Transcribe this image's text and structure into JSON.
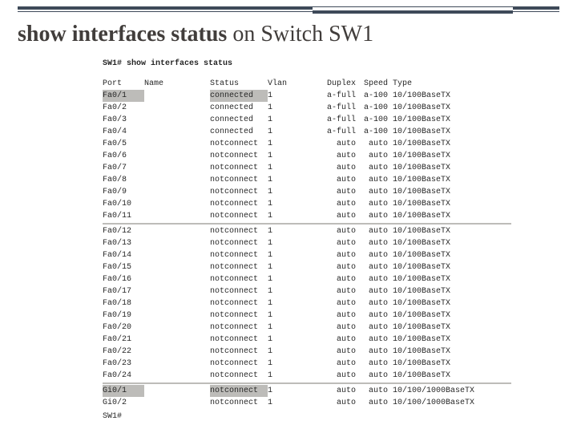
{
  "title_bold": "show interfaces status",
  "title_rest": " on Switch SW1",
  "cmd": "SW1# show interfaces status",
  "headers": {
    "port": "Port",
    "name": "Name",
    "status": "Status",
    "vlan": "Vlan",
    "duplex": "Duplex",
    "speed": "Speed",
    "type": "Type"
  },
  "rows1": [
    {
      "port": "Fa0/1",
      "status": "connected",
      "vlan": "1",
      "duplex": "a-full",
      "speed": "a-100",
      "type": "10/100BaseTX",
      "hl": true
    },
    {
      "port": "Fa0/2",
      "status": "connected",
      "vlan": "1",
      "duplex": "a-full",
      "speed": "a-100",
      "type": "10/100BaseTX",
      "hl": false
    },
    {
      "port": "Fa0/3",
      "status": "connected",
      "vlan": "1",
      "duplex": "a-full",
      "speed": "a-100",
      "type": "10/100BaseTX",
      "hl": false
    },
    {
      "port": "Fa0/4",
      "status": "connected",
      "vlan": "1",
      "duplex": "a-full",
      "speed": "a-100",
      "type": "10/100BaseTX",
      "hl": false
    },
    {
      "port": "Fa0/5",
      "status": "notconnect",
      "vlan": "1",
      "duplex": "auto",
      "speed": "auto",
      "type": "10/100BaseTX",
      "hl": false
    },
    {
      "port": "Fa0/6",
      "status": "notconnect",
      "vlan": "1",
      "duplex": "auto",
      "speed": "auto",
      "type": "10/100BaseTX",
      "hl": false
    },
    {
      "port": "Fa0/7",
      "status": "notconnect",
      "vlan": "1",
      "duplex": "auto",
      "speed": "auto",
      "type": "10/100BaseTX",
      "hl": false
    },
    {
      "port": "Fa0/8",
      "status": "notconnect",
      "vlan": "1",
      "duplex": "auto",
      "speed": "auto",
      "type": "10/100BaseTX",
      "hl": false
    },
    {
      "port": "Fa0/9",
      "status": "notconnect",
      "vlan": "1",
      "duplex": "auto",
      "speed": "auto",
      "type": "10/100BaseTX",
      "hl": false
    },
    {
      "port": "Fa0/10",
      "status": "notconnect",
      "vlan": "1",
      "duplex": "auto",
      "speed": "auto",
      "type": "10/100BaseTX",
      "hl": false
    },
    {
      "port": "Fa0/11",
      "status": "notconnect",
      "vlan": "1",
      "duplex": "auto",
      "speed": "auto",
      "type": "10/100BaseTX",
      "hl": false
    }
  ],
  "rows2": [
    {
      "port": "Fa0/12",
      "status": "notconnect",
      "vlan": "1",
      "duplex": "auto",
      "speed": "auto",
      "type": "10/100BaseTX"
    },
    {
      "port": "Fa0/13",
      "status": "notconnect",
      "vlan": "1",
      "duplex": "auto",
      "speed": "auto",
      "type": "10/100BaseTX"
    },
    {
      "port": "Fa0/14",
      "status": "notconnect",
      "vlan": "1",
      "duplex": "auto",
      "speed": "auto",
      "type": "10/100BaseTX"
    },
    {
      "port": "Fa0/15",
      "status": "notconnect",
      "vlan": "1",
      "duplex": "auto",
      "speed": "auto",
      "type": "10/100BaseTX"
    },
    {
      "port": "Fa0/16",
      "status": "notconnect",
      "vlan": "1",
      "duplex": "auto",
      "speed": "auto",
      "type": "10/100BaseTX"
    },
    {
      "port": "Fa0/17",
      "status": "notconnect",
      "vlan": "1",
      "duplex": "auto",
      "speed": "auto",
      "type": "10/100BaseTX"
    },
    {
      "port": "Fa0/18",
      "status": "notconnect",
      "vlan": "1",
      "duplex": "auto",
      "speed": "auto",
      "type": "10/100BaseTX"
    },
    {
      "port": "Fa0/19",
      "status": "notconnect",
      "vlan": "1",
      "duplex": "auto",
      "speed": "auto",
      "type": "10/100BaseTX"
    },
    {
      "port": "Fa0/20",
      "status": "notconnect",
      "vlan": "1",
      "duplex": "auto",
      "speed": "auto",
      "type": "10/100BaseTX"
    },
    {
      "port": "Fa0/21",
      "status": "notconnect",
      "vlan": "1",
      "duplex": "auto",
      "speed": "auto",
      "type": "10/100BaseTX"
    },
    {
      "port": "Fa0/22",
      "status": "notconnect",
      "vlan": "1",
      "duplex": "auto",
      "speed": "auto",
      "type": "10/100BaseTX"
    },
    {
      "port": "Fa0/23",
      "status": "notconnect",
      "vlan": "1",
      "duplex": "auto",
      "speed": "auto",
      "type": "10/100BaseTX"
    },
    {
      "port": "Fa0/24",
      "status": "notconnect",
      "vlan": "1",
      "duplex": "auto",
      "speed": "auto",
      "type": "10/100BaseTX"
    }
  ],
  "rows3": [
    {
      "port": "Gi0/1",
      "status": "notconnect",
      "vlan": "1",
      "duplex": "auto",
      "speed": "auto",
      "type": "10/100/1000BaseTX",
      "hl": true
    },
    {
      "port": "Gi0/2",
      "status": "notconnect",
      "vlan": "1",
      "duplex": "auto",
      "speed": "auto",
      "type": "10/100/1000BaseTX",
      "hl": false
    }
  ],
  "prompt": "SW1#"
}
